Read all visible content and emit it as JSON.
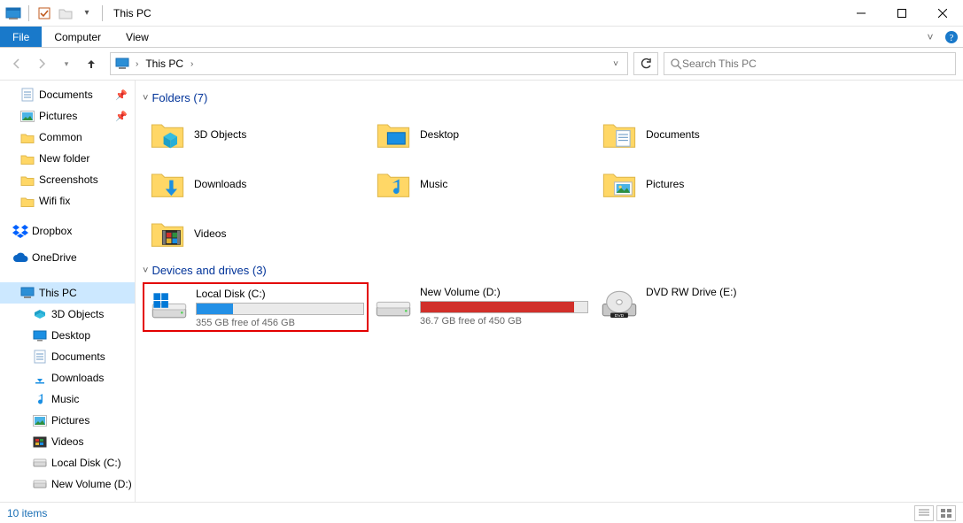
{
  "window": {
    "title": "This PC"
  },
  "ribbon": {
    "file": "File",
    "tabs": [
      "Computer",
      "View"
    ]
  },
  "breadcrumb": {
    "location": "This PC"
  },
  "search": {
    "placeholder": "Search This PC"
  },
  "sidebar": {
    "quick": [
      {
        "label": "Documents",
        "pinned": true,
        "icon": "document"
      },
      {
        "label": "Pictures",
        "pinned": true,
        "icon": "picture"
      },
      {
        "label": "Common",
        "pinned": false,
        "icon": "folder"
      },
      {
        "label": "New folder",
        "pinned": false,
        "icon": "folder"
      },
      {
        "label": "Screenshots",
        "pinned": false,
        "icon": "folder"
      },
      {
        "label": "Wifi fix",
        "pinned": false,
        "icon": "folder"
      }
    ],
    "services": [
      {
        "label": "Dropbox",
        "icon": "dropbox"
      },
      {
        "label": "OneDrive",
        "icon": "onedrive"
      }
    ],
    "thispc": {
      "label": "This PC",
      "children": [
        {
          "label": "3D Objects",
          "icon": "3d"
        },
        {
          "label": "Desktop",
          "icon": "desktop"
        },
        {
          "label": "Documents",
          "icon": "document"
        },
        {
          "label": "Downloads",
          "icon": "download"
        },
        {
          "label": "Music",
          "icon": "music"
        },
        {
          "label": "Pictures",
          "icon": "picture"
        },
        {
          "label": "Videos",
          "icon": "video"
        },
        {
          "label": "Local Disk (C:)",
          "icon": "disk"
        },
        {
          "label": "New Volume (D:)",
          "icon": "disk"
        }
      ]
    }
  },
  "sections": {
    "folders": {
      "title": "Folders (7)",
      "items": [
        {
          "label": "3D Objects",
          "icon": "3d"
        },
        {
          "label": "Desktop",
          "icon": "desktop"
        },
        {
          "label": "Documents",
          "icon": "document"
        },
        {
          "label": "Downloads",
          "icon": "download"
        },
        {
          "label": "Music",
          "icon": "music"
        },
        {
          "label": "Pictures",
          "icon": "picture"
        },
        {
          "label": "Videos",
          "icon": "video"
        }
      ]
    },
    "drives": {
      "title": "Devices and drives (3)",
      "items": [
        {
          "label": "Local Disk (C:)",
          "sub": "355 GB free of 456 GB",
          "fill_pct": 22,
          "fill_color": "#2390e6",
          "highlighted": true,
          "icon": "disk-win"
        },
        {
          "label": "New Volume (D:)",
          "sub": "36.7 GB free of 450 GB",
          "fill_pct": 92,
          "fill_color": "#d12f2a",
          "highlighted": false,
          "icon": "disk"
        },
        {
          "label": "DVD RW Drive (E:)",
          "sub": "",
          "fill_pct": null,
          "fill_color": "",
          "highlighted": false,
          "icon": "dvd"
        }
      ]
    }
  },
  "status": {
    "count": "10 items"
  },
  "icons": {
    "pin": "📌"
  }
}
